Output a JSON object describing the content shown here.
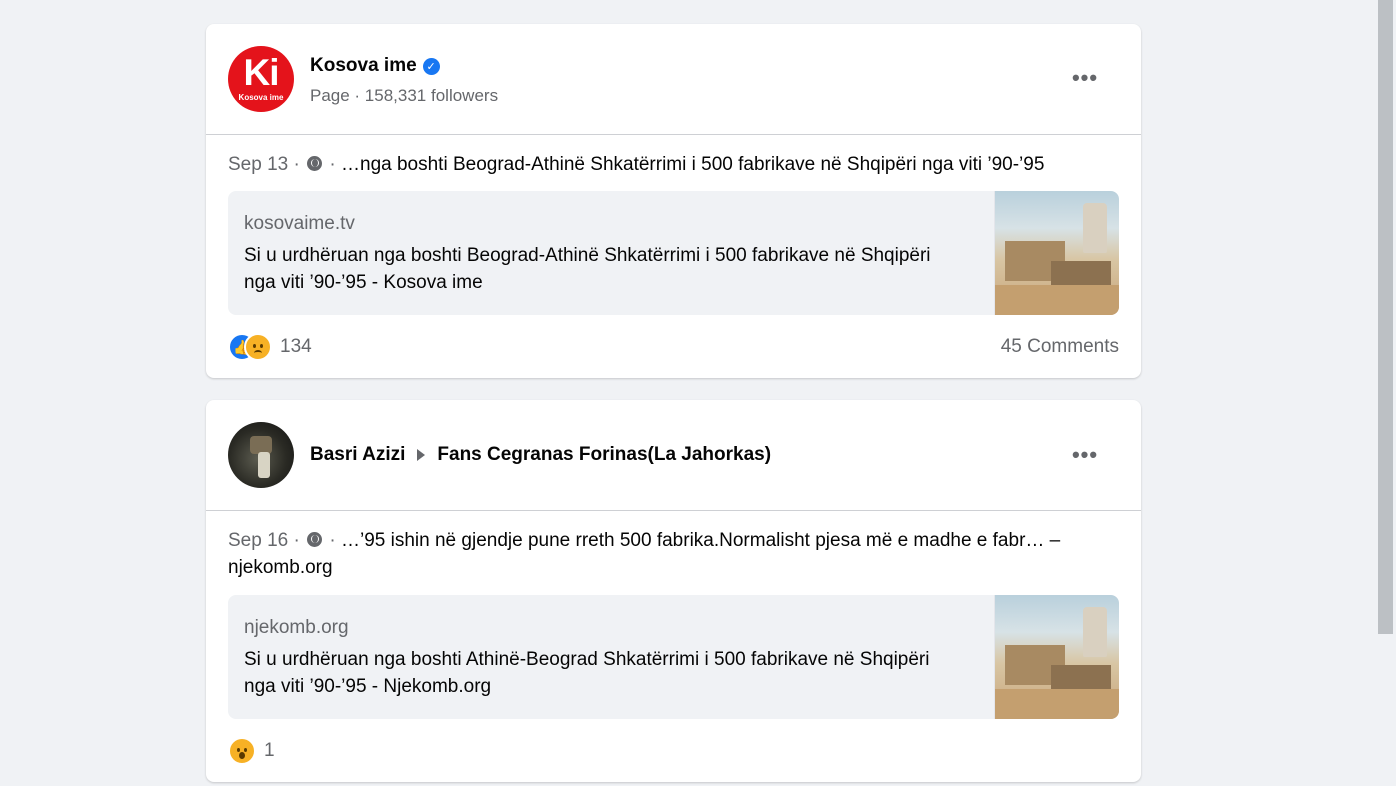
{
  "posts": [
    {
      "author": "Kosova ime",
      "avatar_text": "Ki",
      "avatar_sub": "Kosova ime",
      "meta": "Page · 158,331 followers",
      "date": "Sep 13 ·",
      "after_globe": "·",
      "text": "…nga boshti Beograd-Athinë Shkatërrimi i 500 fabrikave në Shqipëri nga viti ’90-’95",
      "link_domain": "kosovaime.tv",
      "link_title": "Si u urdhëruan nga boshti Beograd-Athinë Shkatërrimi i 500 fabrikave në Shqipëri nga viti ’90-’95 - Kosova ime",
      "reactions": [
        "like-icon",
        "sad-icon"
      ],
      "reaction_count": "134",
      "comments": "45 Comments"
    },
    {
      "author": "Basri Azizi",
      "group": "Fans Cegranas Forinas(La Jahorkas)",
      "date": "Sep 16 ·",
      "after_globe": "·",
      "text": "…’95 ishin në gjendje pune rreth 500 fabrika.Normalisht pjesa më e madhe e fabr… – njekomb.org",
      "link_domain": "njekomb.org",
      "link_title": "Si u urdhëruan nga boshti Athinë-Beograd Shkatërrimi i 500 fabrikave në Shqipëri nga viti ’90-’95 - Njekomb.org",
      "reactions": [
        "wow-icon"
      ],
      "reaction_count": "1"
    }
  ],
  "more_label": "•••",
  "colors": {
    "background": "#f0f2f5",
    "card": "#ffffff",
    "brand_red": "#e4131b",
    "verified_blue": "#1877f2",
    "secondary_text": "#65676b"
  }
}
